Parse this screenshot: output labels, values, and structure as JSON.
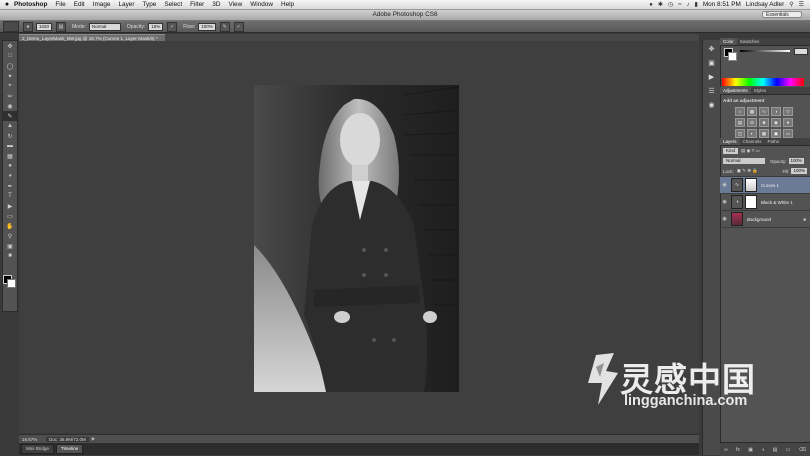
{
  "menubar": {
    "app": "Photoshop",
    "items": [
      "File",
      "Edit",
      "Image",
      "Layer",
      "Type",
      "Select",
      "Filter",
      "3D",
      "View",
      "Window",
      "Help"
    ],
    "clock": "Mon 8:51 PM",
    "user": "Lindsay Adler"
  },
  "window": {
    "title": "Adobe Photoshop CS6",
    "workspace": "Essentials"
  },
  "options": {
    "size_value": "1020",
    "mode_label": "Mode:",
    "mode_value": "Normal",
    "opacity_label": "Opacity:",
    "opacity_value": "15%",
    "flow_label": "Flow:",
    "flow_value": "100%"
  },
  "document": {
    "tab": "2_Demo_LayerMask_BW.jpg @ 16.7% (Curves 1, Layer Mask/8) *",
    "zoom": "16.67%",
    "docsize": "Doc: 36.9M/72.0M"
  },
  "bottom_tabs": [
    "Mini Bridge",
    "Timeline"
  ],
  "panels": {
    "color_tabs": [
      "Color",
      "Swatches"
    ],
    "adjust_tabs": [
      "Adjustments",
      "Styles"
    ],
    "adjust_heading": "Add an adjustment",
    "layers_tabs": [
      "Layers",
      "Channels",
      "Paths"
    ],
    "kind": "Kind",
    "blend": "Normal",
    "opacity_label": "Opacity:",
    "opacity_value": "100%",
    "lock_label": "Lock:",
    "fill_label": "Fill:",
    "fill_value": "100%",
    "layers": [
      {
        "name": "Curves 1",
        "selected": true
      },
      {
        "name": "Black & White 1",
        "selected": false
      },
      {
        "name": "Background",
        "selected": false
      }
    ]
  },
  "watermark": {
    "cn": "灵感中国",
    "url": "lingganchina.com"
  },
  "colors": {
    "selected_layer": "#6b7a97",
    "panel": "#535353",
    "canvas": "#3f3f3f"
  }
}
